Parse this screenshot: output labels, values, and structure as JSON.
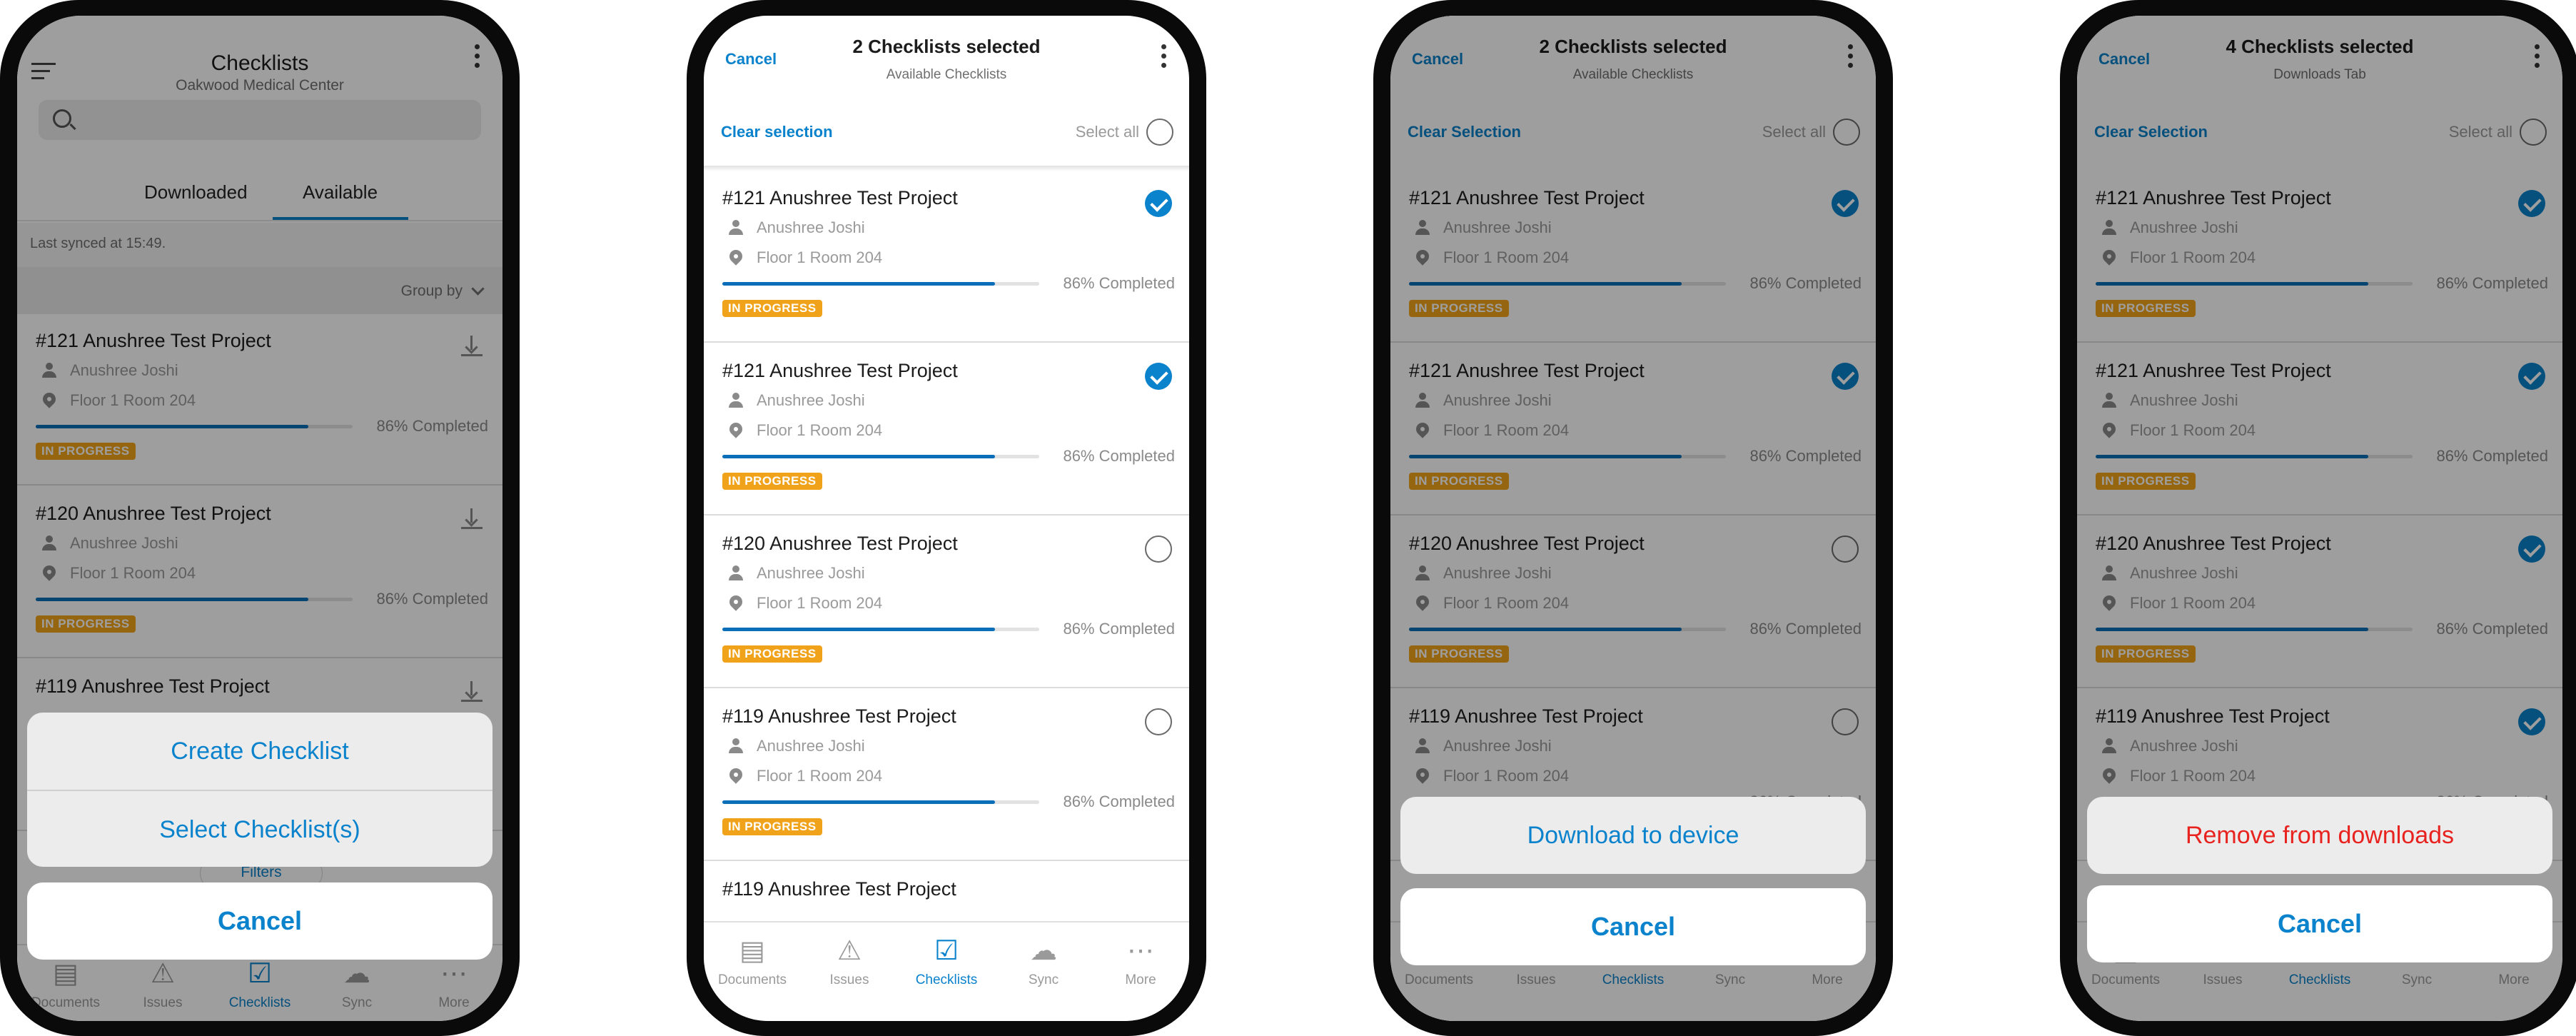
{
  "colors": {
    "accent": "#0a82cc",
    "badge": "#f0a31a",
    "destructive": "#e8231f",
    "progress": "#0a6fb8"
  },
  "project": {
    "name_121": "#121 Anushree Test Project",
    "name_120": "#120 Anushree Test Project",
    "name_119": "#119 Anushree Test Project",
    "assignee": "Anushree Joshi",
    "location": "Floor 1 Room 204",
    "progress_text": "86% Completed",
    "progress": 0.86,
    "status": "IN PROGRESS"
  },
  "screen1": {
    "title": "Checklists",
    "subtitle": "Oakwood Medical Center",
    "search_placeholder": "",
    "tab_downloaded": "Downloaded",
    "tab_available": "Available",
    "last_synced": "Last synced at 15:49.",
    "group_by": "Group by",
    "filters": "Filters",
    "sheet_create": "Create Checklist",
    "sheet_select": "Select Checklist(s)",
    "sheet_cancel": "Cancel"
  },
  "screen2": {
    "cancel": "Cancel",
    "title": "2 Checklists selected",
    "subtitle": "Available Checklists",
    "clear": "Clear selection",
    "select_all": "Select all"
  },
  "screen3": {
    "cancel": "Cancel",
    "title": "2 Checklists selected",
    "subtitle": "Available Checklists",
    "clear": "Clear Selection",
    "select_all": "Select all",
    "sheet_action": "Download to device",
    "sheet_cancel": "Cancel"
  },
  "screen4": {
    "cancel": "Cancel",
    "title": "4 Checklists selected",
    "subtitle": "Downloads Tab",
    "clear": "Clear Selection",
    "select_all": "Select all",
    "sheet_action": "Remove from downloads",
    "sheet_cancel": "Cancel"
  },
  "nav": {
    "documents": "Documents",
    "issues": "Issues",
    "checklists": "Checklists",
    "sync": "Sync",
    "more": "More"
  }
}
